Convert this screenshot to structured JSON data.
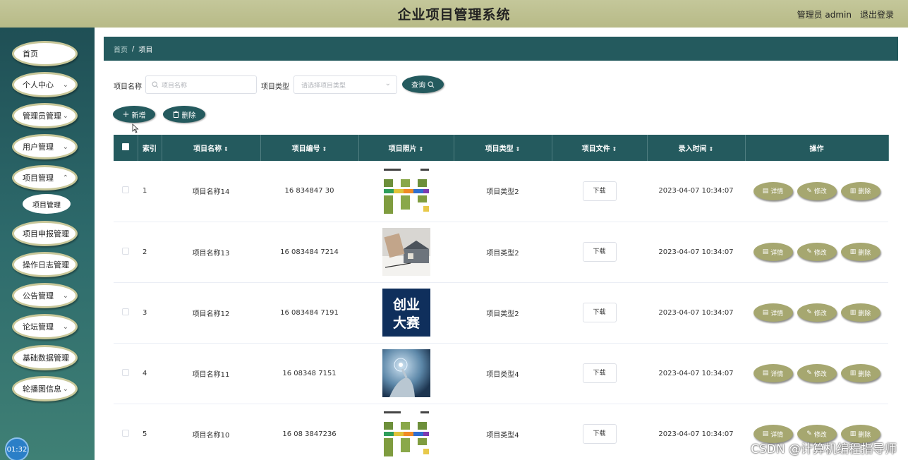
{
  "header": {
    "title": "企业项目管理系统",
    "user": "管理员 admin",
    "logout": "退出登录"
  },
  "sidebar": {
    "items": [
      {
        "label": "首页",
        "has_arrow": false
      },
      {
        "label": "个人中心",
        "has_arrow": true
      },
      {
        "label": "管理员管理",
        "has_arrow": true
      },
      {
        "label": "用户管理",
        "has_arrow": true
      },
      {
        "label": "项目管理",
        "has_arrow": true
      },
      {
        "label": "项目申报管理",
        "has_arrow": true
      },
      {
        "label": "操作日志管理",
        "has_arrow": true
      },
      {
        "label": "公告管理",
        "has_arrow": true
      },
      {
        "label": "论坛管理",
        "has_arrow": true
      },
      {
        "label": "基础数据管理",
        "has_arrow": true
      },
      {
        "label": "轮播图信息",
        "has_arrow": true
      }
    ],
    "submenu": {
      "label": "项目管理"
    }
  },
  "clock": "01:32",
  "breadcrumb": {
    "home": "首页",
    "separator": "/",
    "current": "项目"
  },
  "search": {
    "name_label": "项目名称",
    "name_placeholder": "项目名称",
    "type_label": "项目类型",
    "type_placeholder": "请选择项目类型",
    "query_button": "查询"
  },
  "actions": {
    "add": "新增",
    "delete": "删除"
  },
  "table": {
    "headers": [
      "索引",
      "项目名称",
      "项目编号",
      "项目照片",
      "项目类型",
      "项目文件",
      "录入时间",
      "操作"
    ],
    "rows": [
      {
        "index": "1",
        "name": "项目名称14",
        "code": "16 834847 30",
        "type": "项目类型2",
        "file": "下载",
        "time": "2023-04-07 10:34:07",
        "photo": "flowchart"
      },
      {
        "index": "2",
        "name": "项目名称13",
        "code": "16 083484 7214",
        "type": "项目类型2",
        "file": "下载",
        "time": "2023-04-07 10:34:07",
        "photo": "house-model"
      },
      {
        "index": "3",
        "name": "项目名称12",
        "code": "16 083484 7191",
        "type": "项目类型2",
        "file": "下载",
        "time": "2023-04-07 10:34:07",
        "photo": "poster",
        "photo_text": [
          "创业",
          "大赛"
        ]
      },
      {
        "index": "4",
        "name": "项目名称11",
        "code": "16 08348 7151",
        "type": "项目类型4",
        "file": "下载",
        "time": "2023-04-07 10:34:07",
        "photo": "tech-hand"
      },
      {
        "index": "5",
        "name": "项目名称10",
        "code": "16 08 3847236",
        "type": "项目类型4",
        "file": "下载",
        "time": "2023-04-07 10:34:07",
        "photo": "flowchart"
      }
    ],
    "row_actions": {
      "detail": "详情",
      "edit": "修改",
      "delete": "删除"
    }
  },
  "watermark": "CSDN @计算机编程指导师"
}
